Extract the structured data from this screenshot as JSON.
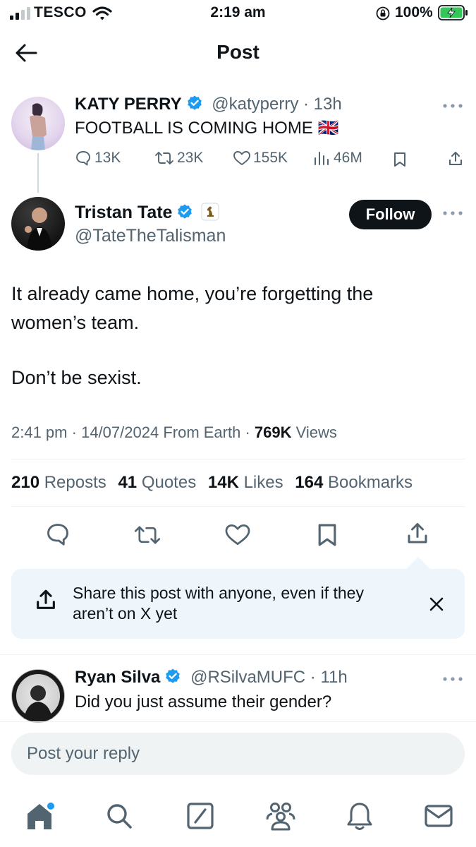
{
  "status_bar": {
    "carrier": "TESCO",
    "time": "2:19 am",
    "battery": "100%"
  },
  "header": {
    "title": "Post"
  },
  "parent_post": {
    "name": "KATY PERRY",
    "handle": "@katyperry",
    "sep": "·",
    "age": "13h",
    "text": "FOOTBALL IS COMING HOME 🇬🇧",
    "replies": "13K",
    "reposts": "23K",
    "likes": "155K",
    "views": "46M"
  },
  "main_post": {
    "name": "Tristan Tate",
    "handle": "@TateTheTalisman",
    "follow_label": "Follow",
    "line1": "It already came home, you’re forgetting the",
    "line2": "women’s team.",
    "line3": "Don’t be sexist.",
    "meta_time": "2:41 pm",
    "sep1": "·",
    "meta_date": "14/07/2024",
    "meta_from": "From Earth",
    "sep2": "·",
    "views_count": "769K",
    "views_label": "Views"
  },
  "stats": {
    "reposts_count": "210",
    "reposts_label": "Reposts",
    "quotes_count": "41",
    "quotes_label": "Quotes",
    "likes_count": "14K",
    "likes_label": "Likes",
    "bookmarks_count": "164",
    "bookmarks_label": "Bookmarks"
  },
  "share_prompt": {
    "line1": "Share this post with anyone, even if they",
    "line2": "aren’t on X yet"
  },
  "reply": {
    "name": "Ryan Silva",
    "handle": "@RSilvaMUFC",
    "sep": "·",
    "age": "11h",
    "text": "Did you just assume their gender?"
  },
  "composer": {
    "placeholder": "Post your reply"
  },
  "colors": {
    "verified": "#1d9bf0",
    "text": "#0f1419",
    "muted": "#536471",
    "share_bg": "#eef6fb",
    "battery": "#34c759"
  },
  "icons": [
    "signal-icon",
    "wifi-icon",
    "orientation-lock-icon",
    "battery-icon",
    "back-arrow-icon",
    "more-icon",
    "reply-icon",
    "repost-icon",
    "like-icon",
    "views-icon",
    "bookmark-icon",
    "share-icon",
    "close-icon",
    "home-icon",
    "search-icon",
    "grok-icon",
    "communities-icon",
    "notifications-icon",
    "messages-icon"
  ]
}
